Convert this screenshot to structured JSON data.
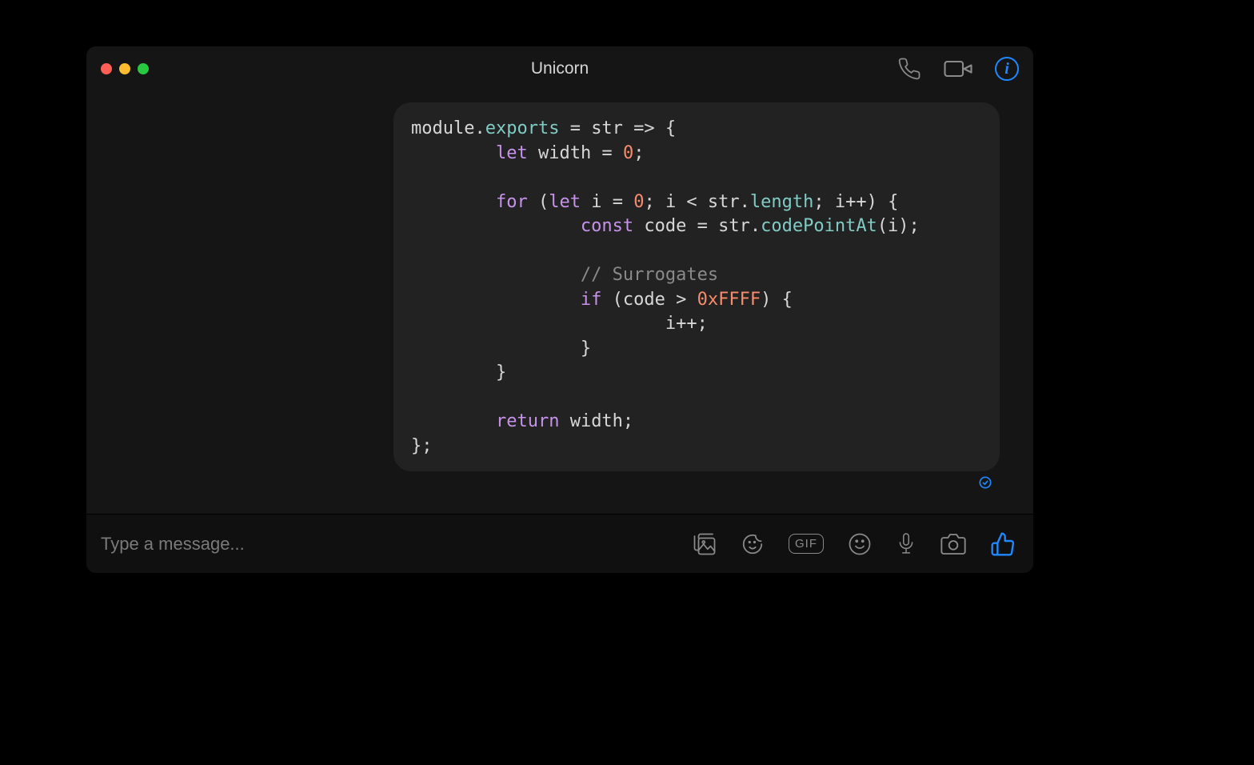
{
  "window": {
    "title": "Unicorn"
  },
  "composer": {
    "placeholder": "Type a message...",
    "gif_label": "GIF"
  },
  "code": {
    "tokens": [
      [
        [
          "default",
          "module"
        ],
        [
          "default",
          "."
        ],
        [
          "prop",
          "exports"
        ],
        [
          "default",
          " = str => {"
        ]
      ],
      [
        [
          "default",
          "        "
        ],
        [
          "kw",
          "let"
        ],
        [
          "default",
          " width = "
        ],
        [
          "num",
          "0"
        ],
        [
          "default",
          ";"
        ]
      ],
      [],
      [
        [
          "default",
          "        "
        ],
        [
          "kw",
          "for"
        ],
        [
          "default",
          " ("
        ],
        [
          "kw",
          "let"
        ],
        [
          "default",
          " i = "
        ],
        [
          "num",
          "0"
        ],
        [
          "default",
          "; i < str."
        ],
        [
          "prop",
          "length"
        ],
        [
          "default",
          "; i++) {"
        ]
      ],
      [
        [
          "default",
          "                "
        ],
        [
          "kw",
          "const"
        ],
        [
          "default",
          " code = str."
        ],
        [
          "prop",
          "codePointAt"
        ],
        [
          "default",
          "(i);"
        ]
      ],
      [],
      [
        [
          "default",
          "                "
        ],
        [
          "comment",
          "// Surrogates"
        ]
      ],
      [
        [
          "default",
          "                "
        ],
        [
          "kw",
          "if"
        ],
        [
          "default",
          " (code > "
        ],
        [
          "num",
          "0xFFFF"
        ],
        [
          "default",
          ") {"
        ]
      ],
      [
        [
          "default",
          "                        i++;"
        ]
      ],
      [
        [
          "default",
          "                }"
        ]
      ],
      [
        [
          "default",
          "        }"
        ]
      ],
      [],
      [
        [
          "default",
          "        "
        ],
        [
          "kw",
          "return"
        ],
        [
          "default",
          " width;"
        ]
      ],
      [
        [
          "default",
          "};"
        ]
      ]
    ]
  }
}
